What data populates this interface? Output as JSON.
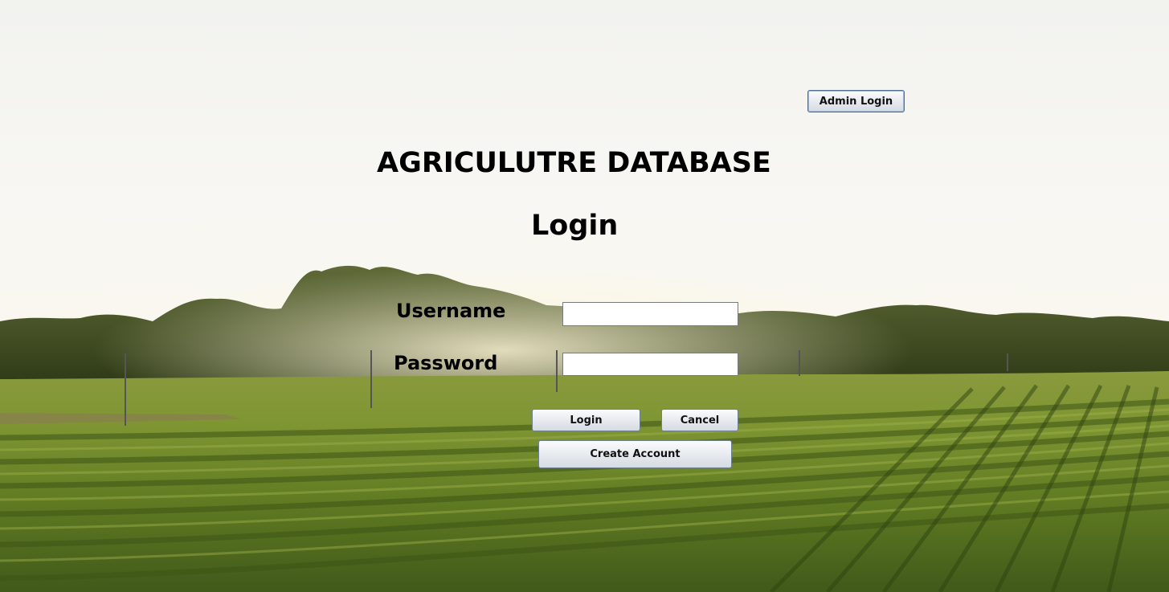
{
  "window": {
    "title": "AGRICULUTRE DATABASE",
    "heading": "Login"
  },
  "header": {
    "admin_login_label": "Admin Login"
  },
  "form": {
    "username_label": "Username",
    "password_label": "Password",
    "username_value": "",
    "password_value": ""
  },
  "actions": {
    "login_label": "Login",
    "cancel_label": "Cancel",
    "create_account_label": "Create Account"
  },
  "colors": {
    "sky": "#f6f5f1",
    "treeline": "#3d4a1e",
    "field": "#6f8a2a",
    "button_border": "#6f7f92"
  },
  "background": {
    "scene": "vineyard-field-photo"
  }
}
